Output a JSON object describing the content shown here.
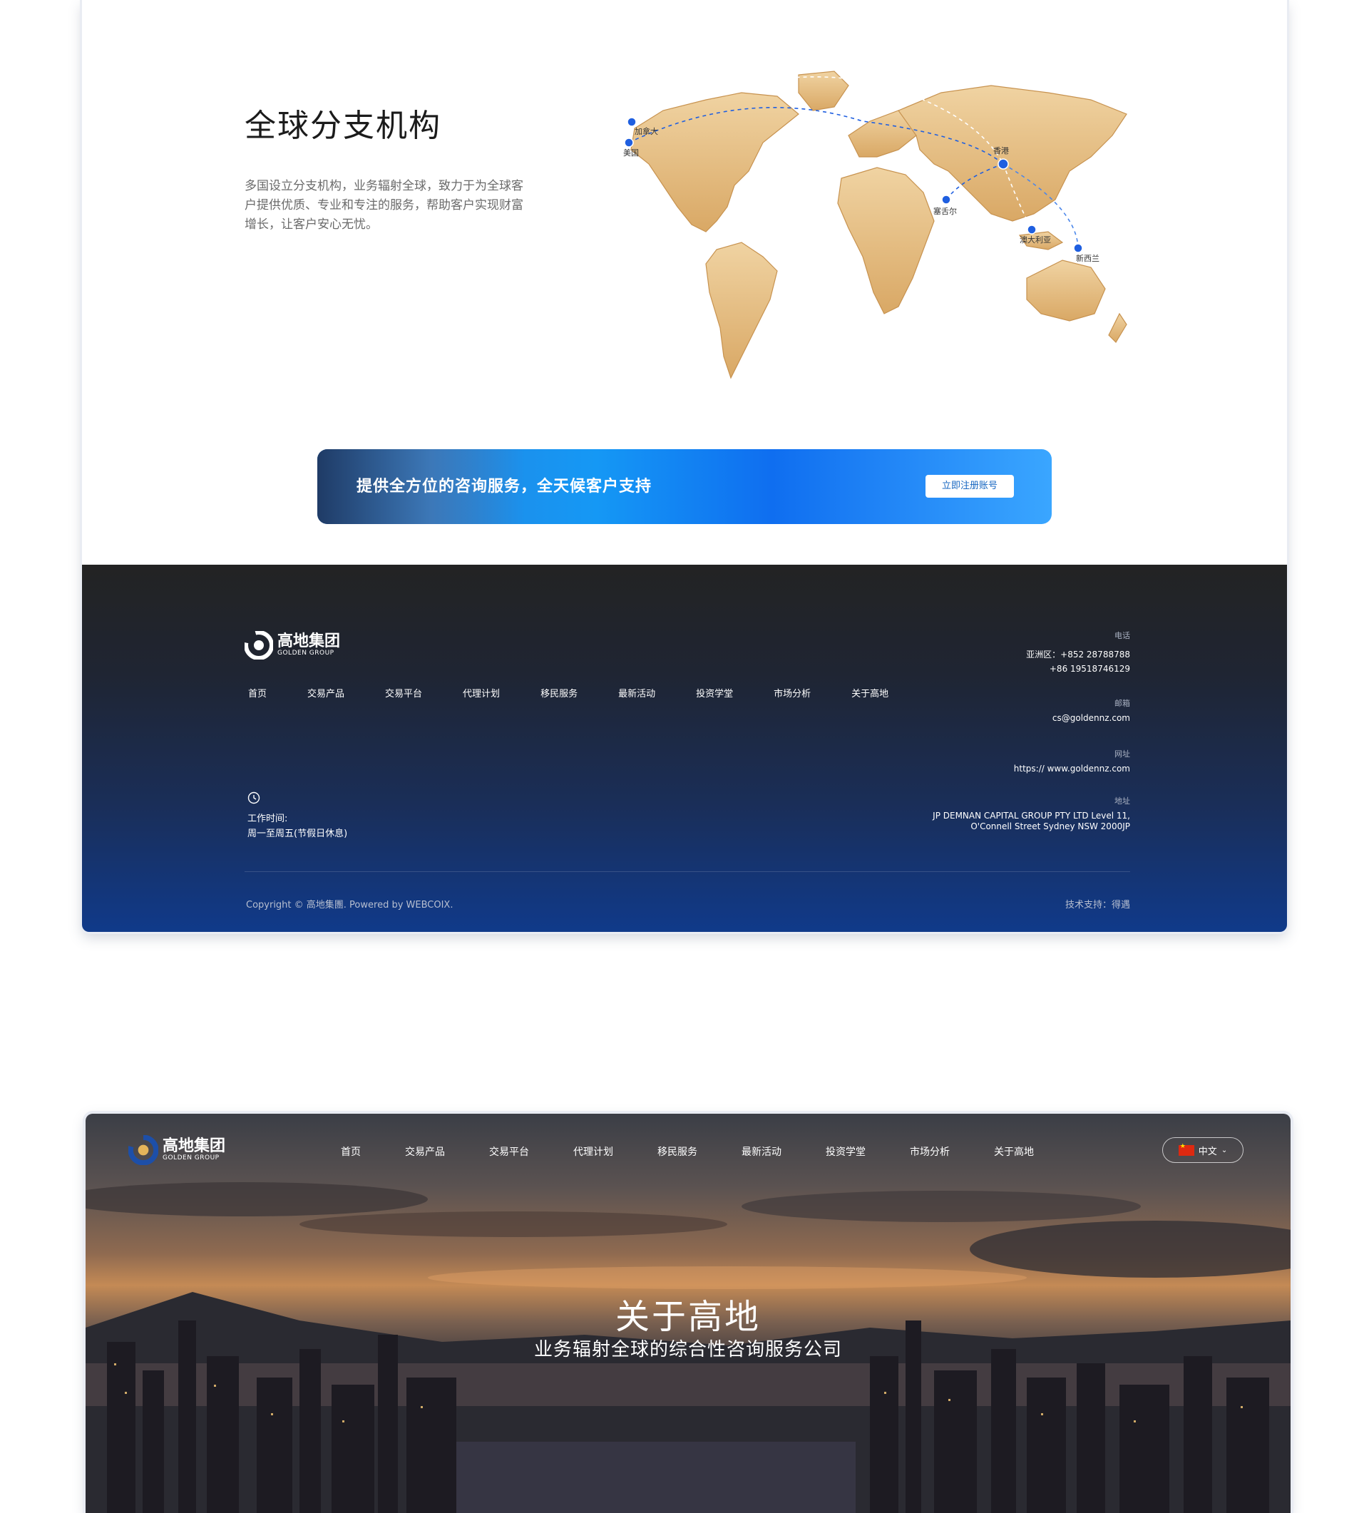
{
  "branches": {
    "title": "全球分支机构",
    "description": "多国设立分支机构，业务辐射全球，致力于为全球客户提供优质、专业和专注的服务，帮助客户实现财富增长，让客户安心无忧。",
    "locations": [
      "加拿大",
      "美国",
      "香港",
      "塞舌尔",
      "澳大利亚",
      "新西兰"
    ]
  },
  "cta": {
    "text": "提供全方位的咨询服务，全天候客户支持",
    "button": "立即注册账号"
  },
  "footer": {
    "logo_cn": "高地集团",
    "logo_en": "GOLDEN GROUP",
    "nav": [
      "首页",
      "交易产品",
      "交易平台",
      "代理计划",
      "移民服务",
      "最新活动",
      "投资学堂",
      "市场分析",
      "关于高地"
    ],
    "phone_label": "电话",
    "phone_1": "亚洲区：+852 28788788",
    "phone_2": "+86 19518746129",
    "email_label": "邮箱",
    "email": "cs@goldennz.com",
    "website_label": "网址",
    "website": "https:// www.goldennz.com",
    "address_label": "地址",
    "address_1": "JP DEMNAN CAPITAL GROUP PTY LTD Level 11,",
    "address_2": "O'Connell Street Sydney NSW 2000JP",
    "hours_label": "工作时间:",
    "hours": "周一至周五(节假日休息)",
    "copyright": "Copyright © 高地集團. Powered by WEBCOIX.",
    "tech_support": "技术支持：得遇"
  },
  "header": {
    "logo_cn": "高地集团",
    "logo_en": "GOLDEN GROUP",
    "nav": [
      "首页",
      "交易产品",
      "交易平台",
      "代理计划",
      "移民服务",
      "最新活动",
      "投资学堂",
      "市场分析",
      "关于高地"
    ],
    "language": "中文"
  },
  "hero": {
    "title": "关于高地",
    "subtitle": "业务辐射全球的综合性咨询服务公司"
  },
  "colors": {
    "map_gold": "#e6c089",
    "pin_blue": "#1f5fe0",
    "footer_dark": "#232323",
    "footer_blue": "#103a8a"
  }
}
